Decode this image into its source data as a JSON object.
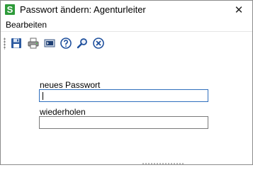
{
  "window": {
    "title": "Passwort ändern: Agenturleiter",
    "logo_letter": "S",
    "close_glyph": "✕"
  },
  "menu": {
    "items": [
      {
        "label": "Bearbeiten"
      }
    ]
  },
  "toolbar": {
    "buttons": [
      {
        "name": "save-icon"
      },
      {
        "name": "print-icon"
      },
      {
        "name": "screen-icon"
      },
      {
        "name": "help-icon"
      },
      {
        "name": "search-icon"
      },
      {
        "name": "close-circle-icon"
      }
    ]
  },
  "form": {
    "new_password_label": "neues Passwort",
    "new_password_value": "",
    "repeat_label": "wiederholen",
    "repeat_value": ""
  },
  "colors": {
    "logo_green": "#2e9b3a",
    "focus_border": "#2f6fbd",
    "icon_blue": "#1e4f9c"
  }
}
